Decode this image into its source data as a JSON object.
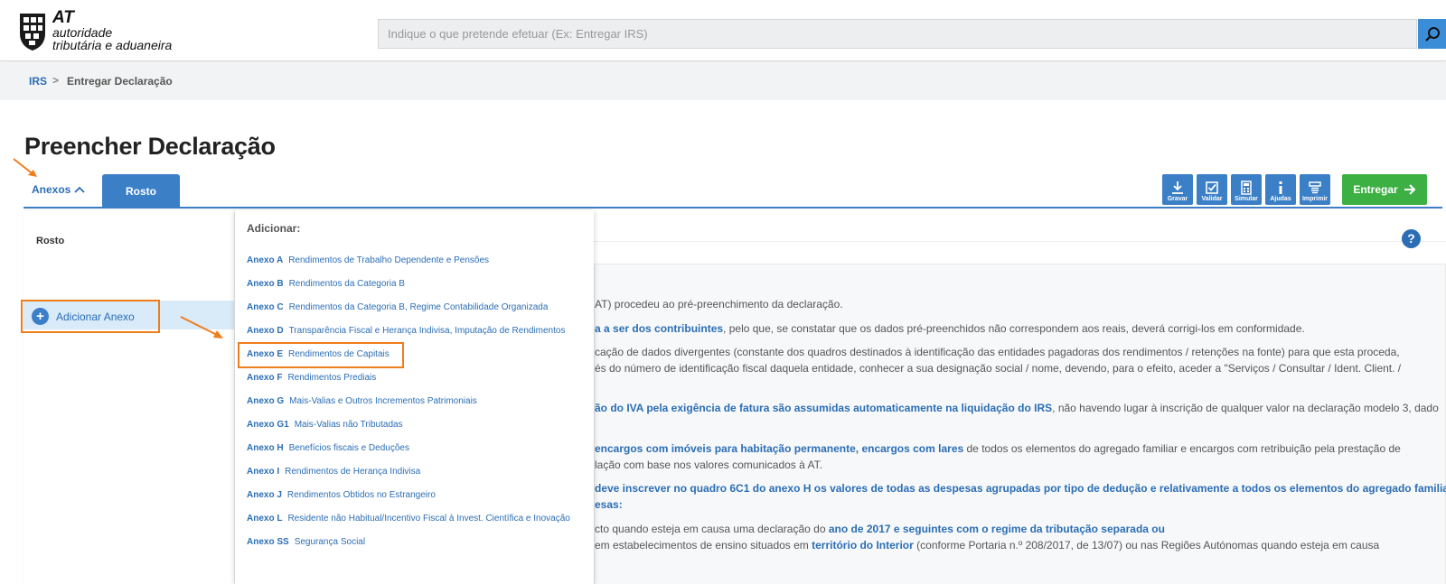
{
  "header": {
    "logo_line1": "AT",
    "logo_line2": "autoridade",
    "logo_line3": "tributária e aduaneira",
    "search_placeholder": "Indique o que pretende efetuar (Ex: Entregar IRS)"
  },
  "breadcrumb": {
    "home": "IRS",
    "separator": ">",
    "current": "Entregar Declaração"
  },
  "page_title": "Preencher Declaração",
  "tabs": {
    "anexos_label": "Anexos",
    "rosto_label": "Rosto"
  },
  "toolbar": {
    "items": [
      {
        "label": "Gravar",
        "icon": "download-icon"
      },
      {
        "label": "Validar",
        "icon": "checkbox-icon"
      },
      {
        "label": "Simular",
        "icon": "calculator-icon"
      },
      {
        "label": "Ajudas",
        "icon": "info-icon"
      },
      {
        "label": "Imprimir",
        "icon": "printer-icon"
      }
    ],
    "submit_label": "Entregar"
  },
  "left_panel": {
    "rosto_item": "Rosto",
    "add_annex_label": "Adicionar Anexo"
  },
  "dropdown": {
    "title": "Adicionar:",
    "items": [
      {
        "code": "Anexo A",
        "desc": "Rendimentos de Trabalho Dependente e Pensões"
      },
      {
        "code": "Anexo B",
        "desc": "Rendimentos da Categoria B"
      },
      {
        "code": "Anexo C",
        "desc": "Rendimentos da Categoria B, Regime Contabilidade Organizada"
      },
      {
        "code": "Anexo D",
        "desc": "Transparência Fiscal e Herança Indivisa, Imputação de Rendimentos"
      },
      {
        "code": "Anexo E",
        "desc": "Rendimentos de Capitais"
      },
      {
        "code": "Anexo F",
        "desc": "Rendimentos Prediais"
      },
      {
        "code": "Anexo G",
        "desc": "Mais-Valias e Outros Incrementos Patrimoniais"
      },
      {
        "code": "Anexo G1",
        "desc": "Mais-Valias não Tributadas"
      },
      {
        "code": "Anexo H",
        "desc": "Benefícios fiscais e Deduções"
      },
      {
        "code": "Anexo I",
        "desc": "Rendimentos de Herança Indivisa"
      },
      {
        "code": "Anexo J",
        "desc": "Rendimentos Obtidos no Estrangeiro"
      },
      {
        "code": "Anexo L",
        "desc": "Residente não Habitual/Incentivo Fiscal à Invest. Científica e Inovação"
      },
      {
        "code": "Anexo SS",
        "desc": "Segurança Social"
      }
    ]
  },
  "help_label": "?",
  "content": {
    "lines": [
      {
        "pre": "",
        "bold": "",
        "post": "AT) procedeu ao pré-preenchimento da declaração."
      },
      {
        "pre": "",
        "bold": "a a ser dos contribuintes",
        "post": ", pelo que, se constatar que os dados pré-preenchidos não correspondem aos reais, deverá corrigi-los em conformidade."
      },
      {
        "pre": "cação de dados divergentes (constante dos quadros destinados à identificação das entidades pagadoras dos rendimentos / retenções na fonte) para que esta proceda,",
        "bold": "",
        "post": ""
      },
      {
        "pre": "és do número de identificação fiscal daquela entidade, conhecer a sua designação social / nome, devendo, para o efeito, aceder a \"Serviços / Consultar / Ident. Client. /",
        "bold": "",
        "post": ""
      },
      {
        "pre": "",
        "bold": "ão do IVA pela exigência de fatura são assumidas automaticamente na liquidação do IRS",
        "post": ", não havendo lugar à inscrição de qualquer valor na declaração modelo 3, dado"
      },
      {
        "pre": "",
        "bold": "encargos com imóveis para habitação permanente, encargos com lares",
        "post": " de todos os elementos do agregado familiar e encargos com retribuição pela prestação de"
      },
      {
        "pre": "lação com base nos valores comunicados à AT.",
        "bold": "",
        "post": ""
      },
      {
        "pre": "",
        "bold": "deve inscrever no quadro 6C1 do anexo H os valores de todas as despesas agrupadas por tipo de dedução e relativamente a todos os elementos do agregado familiar",
        "post": ""
      },
      {
        "pre": "",
        "bold": "esas:",
        "post": ""
      },
      {
        "pre": "cto quando esteja em causa uma declaração do ",
        "bold": "ano de 2017 e seguintes com o regime da tributação separada ou",
        "post": ""
      },
      {
        "pre": "em estabelecimentos de ensino situados em ",
        "bold": "território do Interior",
        "post": " (conforme Portaria n.º 208/2017, de 13/07) ou nas Regiões Autónomas quando esteja em causa"
      }
    ]
  }
}
